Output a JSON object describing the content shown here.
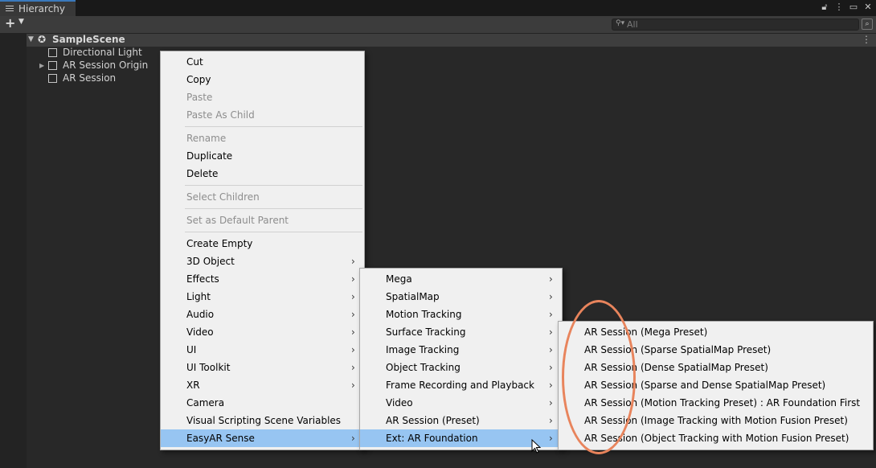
{
  "tab": {
    "title": "Hierarchy"
  },
  "toolbar": {
    "search_placeholder": "All"
  },
  "scene": {
    "name": "SampleScene"
  },
  "objects": [
    "Directional Light",
    "AR Session Origin",
    "AR Session"
  ],
  "menu1": {
    "items": [
      "Cut",
      "Copy",
      "Paste",
      "Paste As Child",
      "Rename",
      "Duplicate",
      "Delete",
      "Select Children",
      "Set as Default Parent",
      "Create Empty",
      "3D Object",
      "Effects",
      "Light",
      "Audio",
      "Video",
      "UI",
      "UI Toolkit",
      "XR",
      "Camera",
      "Visual Scripting Scene Variables",
      "EasyAR Sense"
    ]
  },
  "menu2": {
    "items": [
      "Mega",
      "SpatialMap",
      "Motion Tracking",
      "Surface Tracking",
      "Image Tracking",
      "Object Tracking",
      "Frame Recording and Playback",
      "Video",
      "AR Session (Preset)",
      "Ext: AR Foundation"
    ]
  },
  "menu3": {
    "items": [
      "AR Session (Mega Preset)",
      "AR Session (Sparse SpatialMap Preset)",
      "AR Session (Dense SpatialMap Preset)",
      "AR Session (Sparse and Dense SpatialMap Preset)",
      "AR Session (Motion Tracking Preset) : AR Foundation First",
      "AR Session (Image Tracking with Motion Fusion Preset)",
      "AR Session (Object Tracking with Motion Fusion Preset)"
    ]
  },
  "colors": {
    "highlight": "#97c5f2",
    "annotation": "#e8845c",
    "tab_accent": "#3a79bb"
  }
}
